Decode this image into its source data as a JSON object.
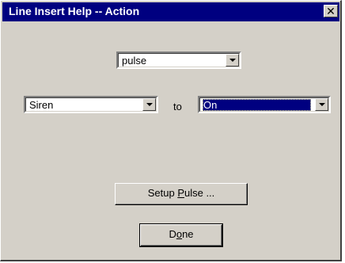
{
  "window": {
    "title": "Line Insert Help -- Action",
    "close_glyph": "✕"
  },
  "action_combo": {
    "value": "pulse"
  },
  "source_combo": {
    "value": "Siren"
  },
  "to_label": "to",
  "target_combo": {
    "value": "On"
  },
  "buttons": {
    "setup_pulse": {
      "prefix": "Setup ",
      "accel": "P",
      "suffix": "ulse ..."
    },
    "done": {
      "prefix": "D",
      "accel": "o",
      "suffix": "ne"
    }
  }
}
